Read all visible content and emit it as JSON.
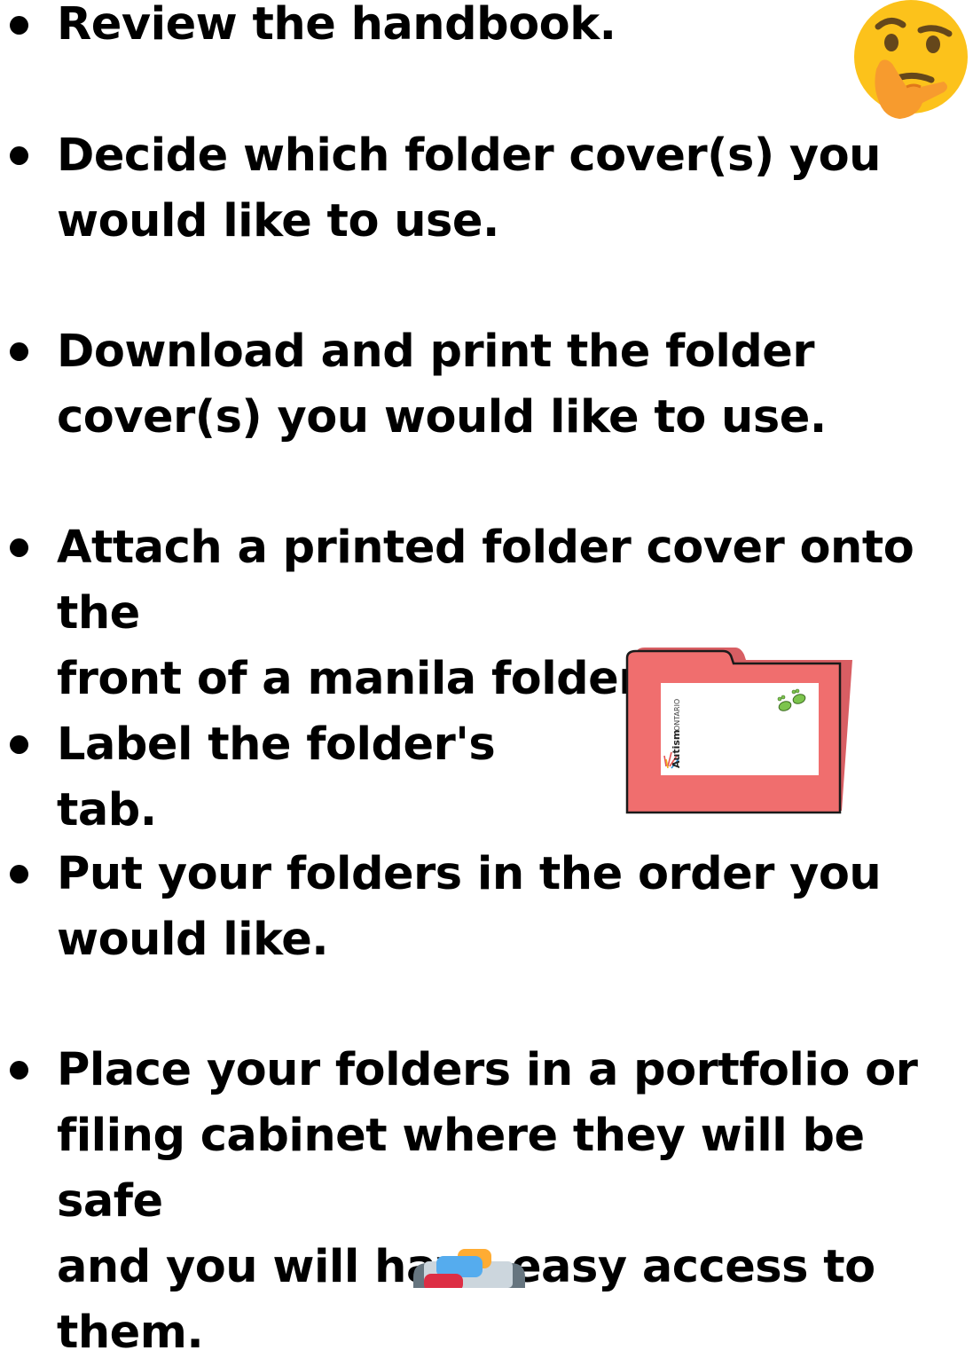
{
  "steps": [
    {
      "text": "Review the handbook."
    },
    {
      "text": "Decide which folder cover(s) you\nwould like to use."
    },
    {
      "text": "Download and print the folder\ncover(s)  you would like to use."
    },
    {
      "text": "Attach a printed folder cover onto the\nfront of a manila folder."
    },
    {
      "text": "Label the folder's tab."
    },
    {
      "text": "Put your folders in the order you\nwould like."
    },
    {
      "text": "Place your folders in a portfolio or\nfiling cabinet where they will be safe\nand you will have easy access to\nthem."
    }
  ],
  "folder_cover": {
    "brand_main": "Autism",
    "brand_secondary": "ONTARIO",
    "colors": {
      "folder": "#f06e6e",
      "folder_back": "#d85e63",
      "outline": "#1a1a1a",
      "cover": "#ffffff",
      "footprints": "#7cc44d"
    }
  },
  "icons": {
    "thinking": "thinking-face-icon",
    "folder": "folder-icon",
    "card_index": "card-index-dividers-icon"
  },
  "colors": {
    "text": "#000000",
    "background": "#ffffff",
    "emoji_face": "#fcc21b",
    "emoji_hand": "#f79b2e"
  }
}
